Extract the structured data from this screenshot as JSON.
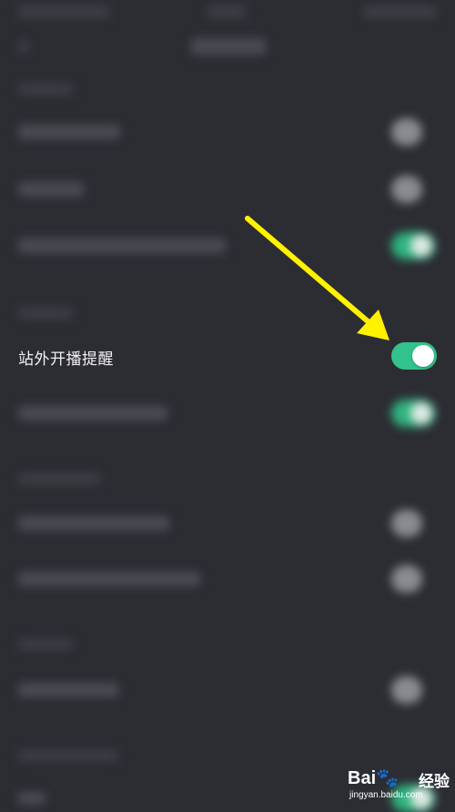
{
  "settings": {
    "focused_row": {
      "label": "站外开播提醒",
      "enabled": true
    }
  },
  "colors": {
    "background": "#2c2d33",
    "toggle_on": "#31c38b",
    "arrow": "#fff200"
  },
  "icons": {
    "annotation_arrow": "arrow-down-right-icon"
  },
  "watermark": {
    "logo_text": "Bai",
    "logo_paw": "du",
    "jingyan": "经验",
    "url": "jingyan.baidu.com"
  }
}
